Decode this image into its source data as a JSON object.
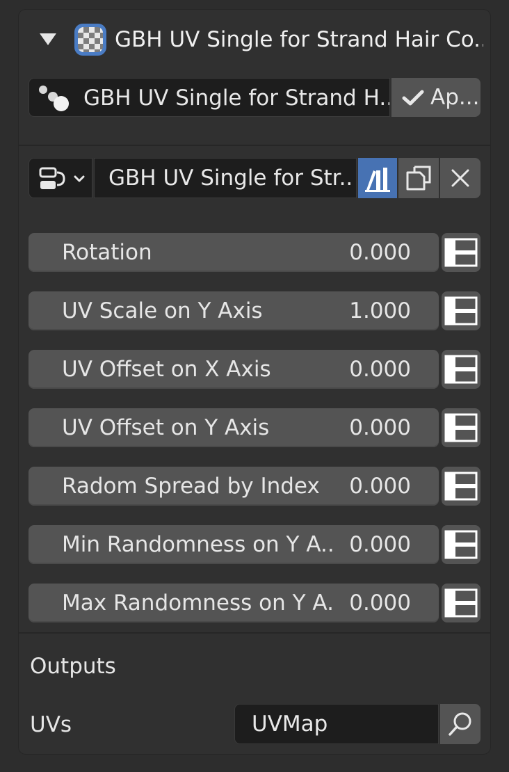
{
  "modifier": {
    "title": "GBH UV Single for Strand Hair Co...",
    "expand_icon": "disclosure-triangle-down-icon",
    "type_icon": "checker-texture-icon"
  },
  "node_group": {
    "name": "GBH UV Single for Strand H...",
    "apply_label": "Ap...",
    "icon": "node-group-dots-icon"
  },
  "datablock": {
    "name": "GBH UV Single for Str...",
    "browse_icon": "node-tree-browse-icon",
    "fake_user_icon": "fake-user-icon",
    "duplicate_icon": "duplicate-icon",
    "unlink_icon": "close-icon"
  },
  "inputs": [
    {
      "label": "Rotation",
      "value": "0.000"
    },
    {
      "label": "UV Scale on Y Axis",
      "value": "1.000"
    },
    {
      "label": "UV Offset on X Axis",
      "value": "0.000"
    },
    {
      "label": "UV Offset on Y Axis",
      "value": "0.000"
    },
    {
      "label": "Radom Spread by Index",
      "value": "0.000"
    },
    {
      "label": "Min Randomness on Y A...",
      "value": "0.000"
    },
    {
      "label": "Max Randomness on Y A...",
      "value": "0.000"
    }
  ],
  "outputs": {
    "section_label": "Outputs",
    "uvs_label": "UVs",
    "uvs_value": "UVMap",
    "search_icon": "search-icon"
  },
  "colors": {
    "panel_bg": "#303030",
    "field_bg": "#545454",
    "dark_field_bg": "#1d1d1d",
    "accent_blue": "#4772b3"
  }
}
